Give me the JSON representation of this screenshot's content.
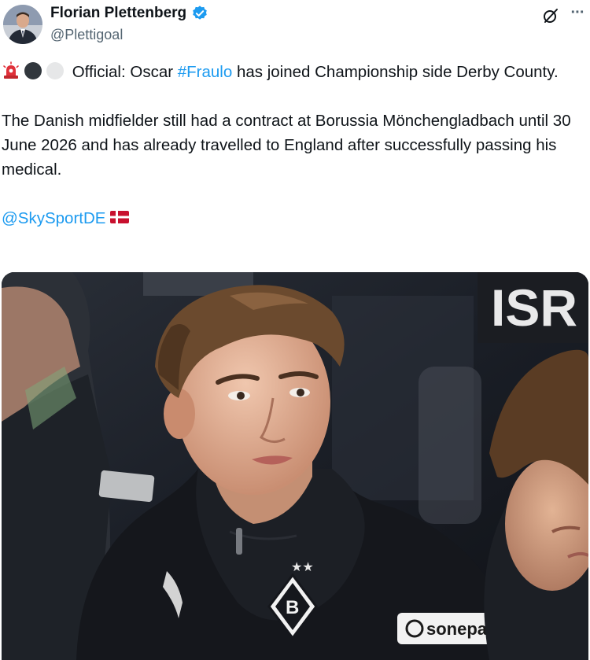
{
  "author": {
    "display_name": "Florian Plettenberg",
    "handle": "@Plettigoal",
    "verified": true,
    "avatar_icon": "avatar"
  },
  "actions": {
    "grok_icon": "grok-icon",
    "more_icon": "more-icon"
  },
  "tweet": {
    "line1_prefix": "Official: Oscar ",
    "hashtag": "#Fraulo",
    "line1_suffix": " has joined Championship side Derby County.",
    "paragraph2": "The Danish midfielder still had a contract at Borussia Mönchengladbach until 30 June 2026 and has already travelled to England after successfully passing his medical.",
    "mention": "@SkySportDE",
    "leading_emojis": [
      "rotating-light",
      "black-circle",
      "white-circle"
    ],
    "trailing_emoji": "denmark-flag"
  },
  "media": {
    "background_sign_text": "ISR",
    "sponsor_text": "sonepar",
    "colors": {
      "jacket": "#15171c",
      "skin": "#e7b89e",
      "hair": "#6b4a2e",
      "background": "#1b1f27"
    }
  },
  "colors": {
    "link": "#1d9bf0",
    "verified": "#1d9bf0",
    "text": "#0f1419",
    "secondary": "#536471"
  }
}
